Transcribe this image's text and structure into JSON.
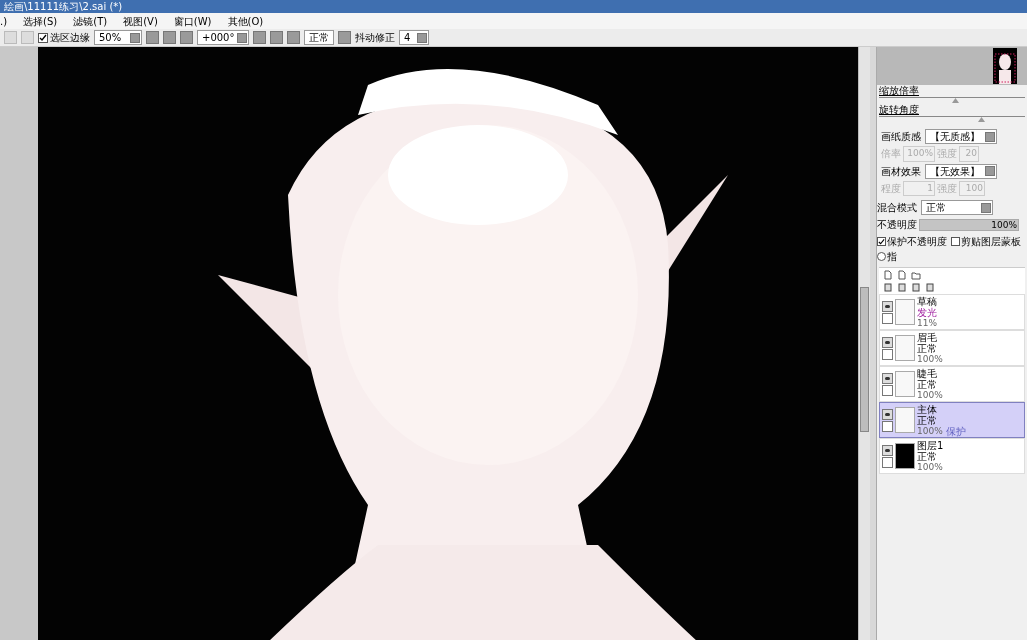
{
  "window": {
    "title": "絵画\\11111练习\\2.sai (*)"
  },
  "menu": [
    {
      "label": ".)"
    },
    {
      "label": "选择(S)"
    },
    {
      "label": "滤镜(T)"
    },
    {
      "label": "视图(V)"
    },
    {
      "label": "窗口(W)"
    },
    {
      "label": "其他(O)"
    }
  ],
  "toolbar": {
    "selection_edge": {
      "label": "选区边缘",
      "checked": true
    },
    "zoom": "50%",
    "rotation": "+000°",
    "mode": "正常",
    "stabilizer_label": "抖动修正",
    "stabilizer": "4"
  },
  "navigator": {
    "zoom": {
      "label": "缩放倍率",
      "level": 0.52
    },
    "rotate": {
      "label": "旋转角度",
      "level": 0.71
    }
  },
  "texture": {
    "paper_label": "画纸质感",
    "paper_value": "【无质感】",
    "paper_scale_label": "倍率",
    "paper_scale": "100%",
    "paper_strength_label": "强度",
    "paper_strength": "20",
    "effect_label": "画材效果",
    "effect_value": "【无效果】",
    "effect_degree_label": "程度",
    "effect_degree": "1",
    "effect_strength_label": "强度",
    "effect_strength": "100"
  },
  "blend": {
    "label": "混合模式",
    "value": "正常"
  },
  "opacity": {
    "label": "不透明度",
    "reading": "100%",
    "level": 1
  },
  "options": [
    {
      "kind": "checkbox",
      "label": "保护不透明度",
      "checked": true
    },
    {
      "kind": "checkbox",
      "label": "剪贴图层蒙板",
      "checked": false
    },
    {
      "kind": "radio",
      "label": "指",
      "checked": false
    }
  ],
  "layers": [
    {
      "name": "草稿",
      "mode": "发光",
      "opacity": "11%",
      "selected": false,
      "visible": true,
      "kind": "light",
      "special_mode": true
    },
    {
      "name": "眉毛",
      "mode": "正常",
      "opacity": "100%",
      "selected": false,
      "visible": true,
      "kind": "light",
      "special_mode": false
    },
    {
      "name": "睫毛",
      "mode": "正常",
      "opacity": "100%",
      "selected": false,
      "visible": true,
      "kind": "light",
      "special_mode": false
    },
    {
      "name": "主体",
      "mode": "正常",
      "opacity": "100%",
      "protect": "保护",
      "selected": true,
      "visible": true,
      "kind": "light",
      "special_mode": false
    },
    {
      "name": "图层1",
      "mode": "正常",
      "opacity": "100%",
      "selected": false,
      "visible": true,
      "kind": "dark",
      "special_mode": false
    }
  ]
}
